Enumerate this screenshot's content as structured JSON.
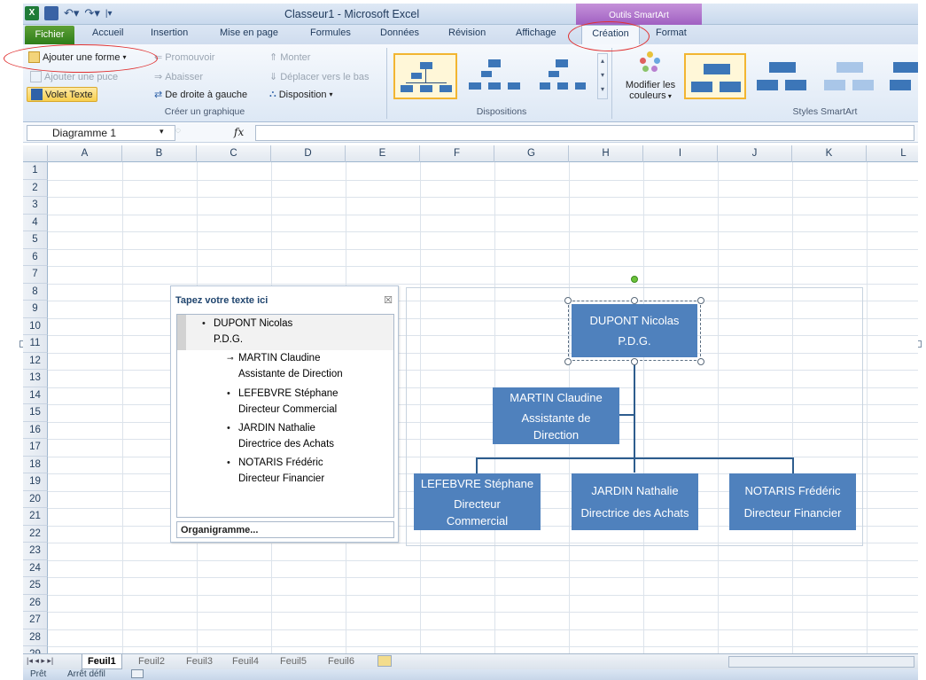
{
  "window": {
    "title": "Classeur1 - Microsoft Excel",
    "contextual_tab_group": "Outils SmartArt"
  },
  "tabs": [
    "Fichier",
    "Accueil",
    "Insertion",
    "Mise en page",
    "Formules",
    "Données",
    "Révision",
    "Affichage",
    "Création",
    "Format"
  ],
  "active_tab": "Création",
  "ribbon": {
    "create_group": {
      "add_shape": "Ajouter une forme",
      "add_bullet": "Ajouter une puce",
      "text_pane": "Volet Texte",
      "promote": "Promouvoir",
      "demote": "Abaisser",
      "right_to_left": "De droite à gauche",
      "move_up": "Monter",
      "move_down": "Déplacer vers le bas",
      "layout": "Disposition",
      "label": "Créer un graphique"
    },
    "layouts_group": {
      "label": "Dispositions"
    },
    "styles_group": {
      "change_colors_line1": "Modifier les",
      "change_colors_line2": "couleurs",
      "label": "Styles SmartArt"
    }
  },
  "formula_bar": {
    "name_box": "Diagramme 1",
    "fx": "fx",
    "content": ""
  },
  "columns": [
    "A",
    "B",
    "C",
    "D",
    "E",
    "F",
    "G",
    "H",
    "I",
    "J",
    "K",
    "L"
  ],
  "rows": [
    "1",
    "2",
    "3",
    "4",
    "5",
    "6",
    "7",
    "8",
    "9",
    "10",
    "11",
    "12",
    "13",
    "14",
    "15",
    "16",
    "17",
    "18",
    "19",
    "20",
    "21",
    "22",
    "23",
    "24",
    "25",
    "26",
    "27",
    "28",
    "29"
  ],
  "text_pane": {
    "title": "Tapez votre texte ici",
    "close": "☒",
    "items": [
      {
        "line1": "DUPONT Nicolas",
        "line2": "P.D.G.",
        "level": 1
      },
      {
        "line1": "MARTIN Claudine",
        "line2": "Assistante de Direction",
        "level": 2,
        "assistant": true
      },
      {
        "line1": "LEFEBVRE Stéphane",
        "line2": "Directeur Commercial",
        "level": 2
      },
      {
        "line1": "JARDIN Nathalie",
        "line2": "Directrice des Achats",
        "level": 2
      },
      {
        "line1": "NOTARIS Frédéric",
        "line2": "Directeur Financier",
        "level": 2
      }
    ],
    "footer": "Organigramme..."
  },
  "org_chart": {
    "top": {
      "name": "DUPONT Nicolas",
      "role": "P.D.G."
    },
    "assistant": {
      "name": "MARTIN Claudine",
      "role_line1": "Assistante de",
      "role_line2": "Direction"
    },
    "subordinates": [
      {
        "name": "LEFEBVRE Stéphane",
        "role_line1": "Directeur",
        "role_line2": "Commercial"
      },
      {
        "name": "JARDIN Nathalie",
        "role_line1": "Directrice des Achats",
        "role_line2": ""
      },
      {
        "name": "NOTARIS Frédéric",
        "role_line1": "Directeur Financier",
        "role_line2": ""
      }
    ],
    "box_color": "#4f81bd",
    "line_color": "#2e5d8e"
  },
  "sheets": [
    "Feuil1",
    "Feuil2",
    "Feuil3",
    "Feuil4",
    "Feuil5",
    "Feuil6"
  ],
  "active_sheet": "Feuil1",
  "status": {
    "ready": "Prêt",
    "scroll_lock": "Arrêt défil"
  },
  "colors": {
    "annotation": "#e03030",
    "selection": "#f2b531",
    "accent": "#4f81bd"
  }
}
